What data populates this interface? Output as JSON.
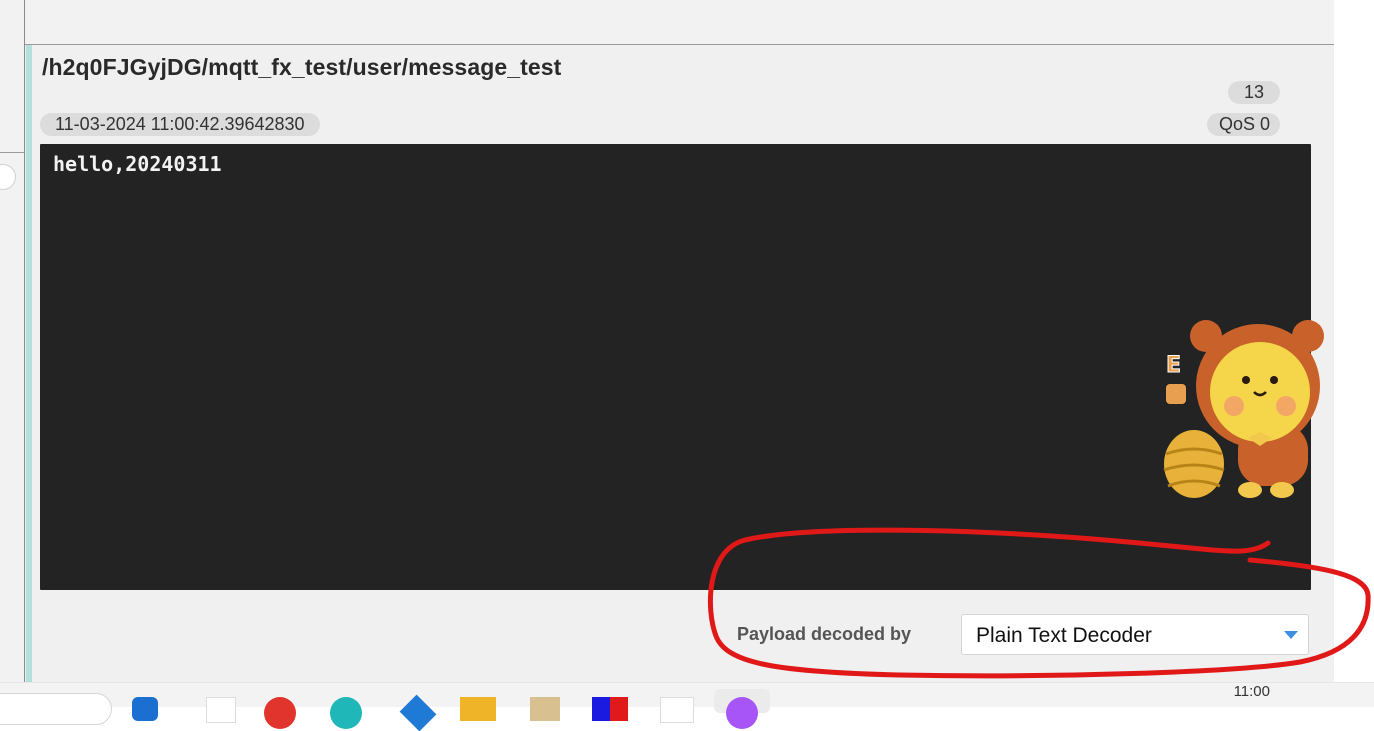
{
  "message": {
    "topic": "/h2q0FJGyjDG/mqtt_fx_test/user/message_test",
    "count": "13",
    "timestamp": "11-03-2024  11:00:42.39642830",
    "qos": "QoS 0",
    "payload": "hello,20240311"
  },
  "decoder": {
    "label": "Payload decoded by",
    "selected": "Plain Text Decoder",
    "icon": "chevron-down-icon"
  },
  "taskbar": {
    "clock": "11:00"
  },
  "colors": {
    "accent": "#b4e0dc",
    "payload_bg": "#232323",
    "annotation": "#e01818",
    "dropdown_caret": "#3d8fe0"
  }
}
